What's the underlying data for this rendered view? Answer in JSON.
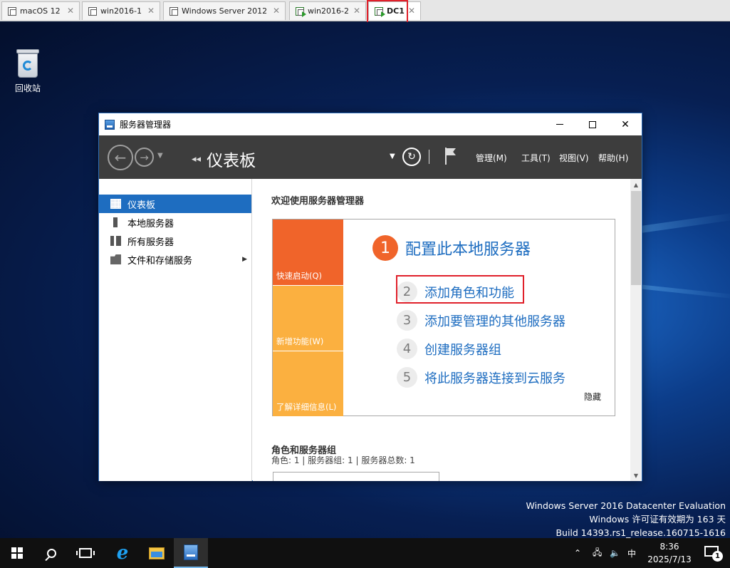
{
  "vm_tabs": [
    {
      "label": "macOS 12"
    },
    {
      "label": "win2016-1"
    },
    {
      "label": "Windows Server 2012"
    },
    {
      "label": "win2016-2"
    },
    {
      "label": "DC1"
    }
  ],
  "desktop": {
    "recycle_bin_label": "回收站",
    "watermark": {
      "line1": "Windows Server 2016 Datacenter Evaluation",
      "line2": "Windows 许可证有效期为 163 天",
      "line3": "Build 14393.rs1_release.160715-1616"
    }
  },
  "window": {
    "title": "服务器管理器",
    "breadcrumb": "仪表板",
    "menu": {
      "manage": "管理(M)",
      "tools": "工具(T)",
      "view": "视图(V)",
      "help": "帮助(H)"
    }
  },
  "sidebar": {
    "items": [
      {
        "label": "仪表板",
        "icon": "dashboard-icon",
        "selected": true
      },
      {
        "label": "本地服务器",
        "icon": "server-icon"
      },
      {
        "label": "所有服务器",
        "icon": "servers-icon"
      },
      {
        "label": "文件和存储服务",
        "icon": "file-storage-icon",
        "has_submenu": true
      }
    ]
  },
  "main": {
    "welcome_title": "欢迎使用服务器管理器",
    "quick_start": {
      "tiles": [
        "快速启动(Q)",
        "新增功能(W)",
        "了解详细信息(L)"
      ],
      "steps": [
        {
          "num": "1",
          "label": "配置此本地服务器"
        },
        {
          "num": "2",
          "label": "添加角色和功能"
        },
        {
          "num": "3",
          "label": "添加要管理的其他服务器"
        },
        {
          "num": "4",
          "label": "创建服务器组"
        },
        {
          "num": "5",
          "label": "将此服务器连接到云服务"
        }
      ],
      "hide_label": "隐藏"
    },
    "roles": {
      "title": "角色和服务器组",
      "summary": "角色: 1 | 服务器组: 1 | 服务器总数: 1"
    }
  },
  "taskbar": {
    "ime": "中",
    "time": "8:36",
    "date": "2025/7/13",
    "notification_count": "1"
  },
  "colors": {
    "highlight_box": "#e0202a",
    "selection_blue": "#1e6dc0",
    "orange": "#f0642a",
    "amber": "#fbb040",
    "toolbar": "#3d3d3d"
  }
}
